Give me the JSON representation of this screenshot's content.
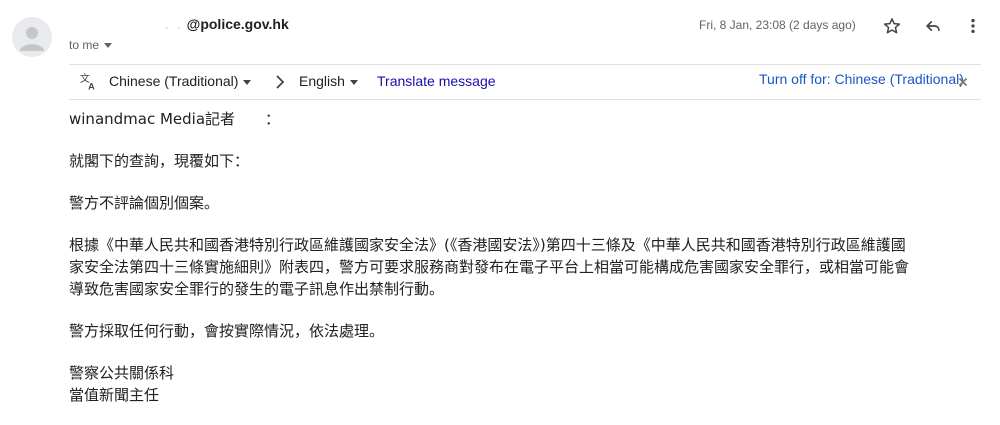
{
  "header": {
    "sender_redacted": ".   .",
    "sender_domain": "@police.gov.hk",
    "to_label": "to me",
    "date": "Fri, 8 Jan, 23:08 (2 days ago)"
  },
  "icons": {
    "star": "star-icon",
    "reply": "reply-icon",
    "more": "more-vert-icon",
    "translate": "translate-icon",
    "close": "close-icon"
  },
  "translate_bar": {
    "source_lang": "Chinese (Traditional)",
    "target_lang": "English",
    "translate_label": "Translate message",
    "turn_off_label": "Turn off for: Chinese (Traditional)"
  },
  "message": {
    "greeting": "winandmac Media記者　　：",
    "line1": "就閣下的查詢，現覆如下：",
    "line2": "警方不評論個別個案。",
    "para3_l1": "根據《中華人民共和國香港特別行政區維護國家安全法》(《香港國安法》)第四十三條及《中華人民共和國香港特別行政區維護國",
    "para3_l2": "家安全法第四十三條實施細則》附表四，警方可要求服務商對發布在電子平台上相當可能構成危害國家安全罪行，或相當可能會",
    "para3_l3": "導致危害國家安全罪行的發生的電子訊息作出禁制行動。",
    "line4": "警方採取任何行動，會按實際情況，依法處理。",
    "sig1": "警察公共關係科",
    "sig2": "當值新聞主任"
  },
  "colors": {
    "link": "#1a0dab",
    "text": "#202124",
    "muted": "#5f6368"
  }
}
